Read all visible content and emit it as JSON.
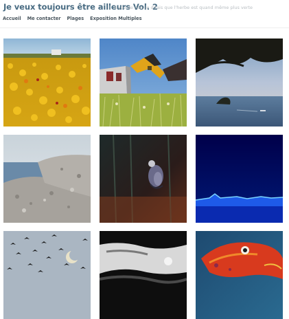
{
  "site": {
    "title": "Je veux toujours être ailleurs Vol. 2",
    "tagline": "À vue de nez, je dirais que l'herbe est quand même plus verte"
  },
  "nav": {
    "items": [
      {
        "label": "Accueil"
      },
      {
        "label": "Me contacter"
      },
      {
        "label": "Plages"
      },
      {
        "label": "Exposition Multiples"
      }
    ]
  },
  "colors": {
    "title": "#486b82",
    "nav": "#4a565e",
    "tagline": "#b8bec2"
  },
  "gallery": {
    "tiles": [
      {
        "subject": "yellow wildflower field"
      },
      {
        "subject": "yellow excavator arm beside building"
      },
      {
        "subject": "island at dusk under tree branches"
      },
      {
        "subject": "rocks at seaside"
      },
      {
        "subject": "bird in dark water"
      },
      {
        "subject": "blue waves at night"
      },
      {
        "subject": "birds flying with crescent moon"
      },
      {
        "subject": "black and white water reflection"
      },
      {
        "subject": "red fish painting"
      }
    ]
  }
}
